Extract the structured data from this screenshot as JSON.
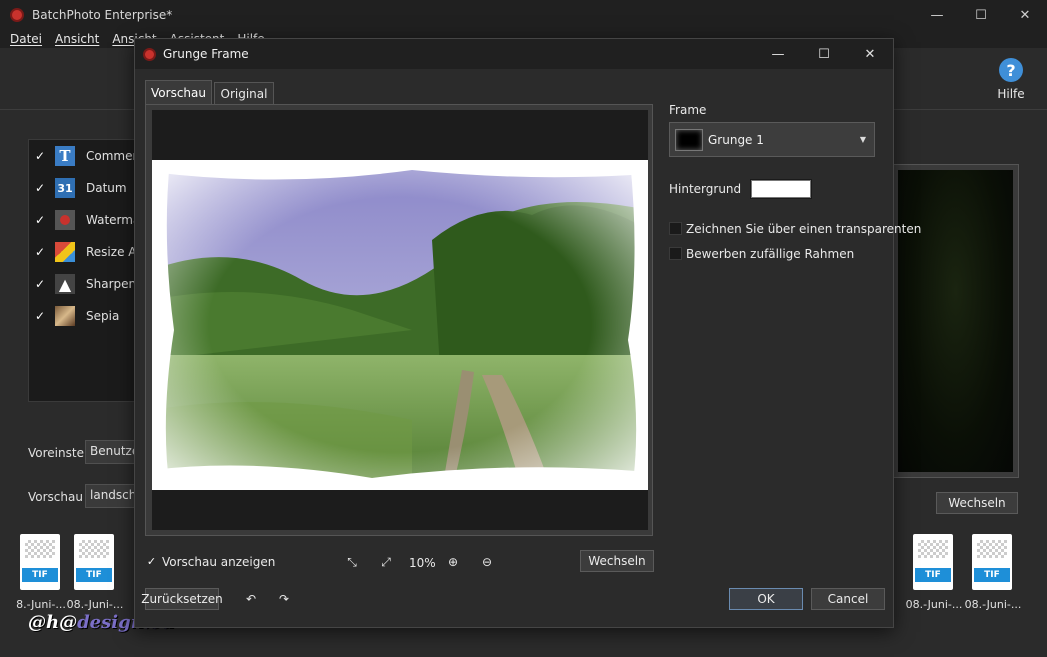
{
  "app": {
    "title": "BatchPhoto Enterprise*",
    "menu": [
      "Datei",
      "Ansicht",
      "Ansicht",
      "Assistent",
      "Hilfe"
    ],
    "help_label": "Hilfe",
    "window_controls": {
      "minimize": "—",
      "maximize": "☐",
      "close": "✕"
    }
  },
  "filters": [
    {
      "label": "Comment",
      "checked": true,
      "icon": "text-t-icon"
    },
    {
      "label": "Datum",
      "checked": true,
      "icon": "calendar-31-icon"
    },
    {
      "label": "Watermark",
      "checked": true,
      "icon": "watermark-icon"
    },
    {
      "label": "Resize Ad",
      "checked": true,
      "icon": "resize-icon"
    },
    {
      "label": "Sharpen A",
      "checked": true,
      "icon": "sharpen-icon"
    },
    {
      "label": "Sepia",
      "checked": true,
      "icon": "sepia-icon"
    }
  ],
  "side": {
    "preset_label": "Voreinstell",
    "preset_value": "Benutzer",
    "preview_label": "Vorschau",
    "preview_value": "landschaft",
    "switch_button": "Wechseln"
  },
  "filmstrip": [
    {
      "tag": "TIF",
      "label": "8.-Juni-..."
    },
    {
      "tag": "TIF",
      "label": "08.-Juni-..."
    },
    {
      "tag": "TIF",
      "label": "08.-Juni-..."
    },
    {
      "tag": "TIF",
      "label": "08.-Juni-..."
    }
  ],
  "watermark": {
    "prefix": "@h@",
    "suffix": "design.eu"
  },
  "dialog": {
    "title": "Grunge Frame",
    "tabs": [
      "Vorschau",
      "Original"
    ],
    "frame_label": "Frame",
    "frame_value": "Grunge 1",
    "background_label": "Hintergrund",
    "background_color": "#ffffff",
    "option_transparent": "Zeichnen Sie über einen transparenten",
    "option_random": "Bewerben zufällige Rahmen",
    "show_preview_label": "Vorschau anzeigen",
    "show_preview_checked": true,
    "zoom": "10%",
    "switch_button": "Wechseln",
    "reset_button": "Zurücksetzen",
    "ok_button": "OK",
    "cancel_button": "Cancel"
  }
}
